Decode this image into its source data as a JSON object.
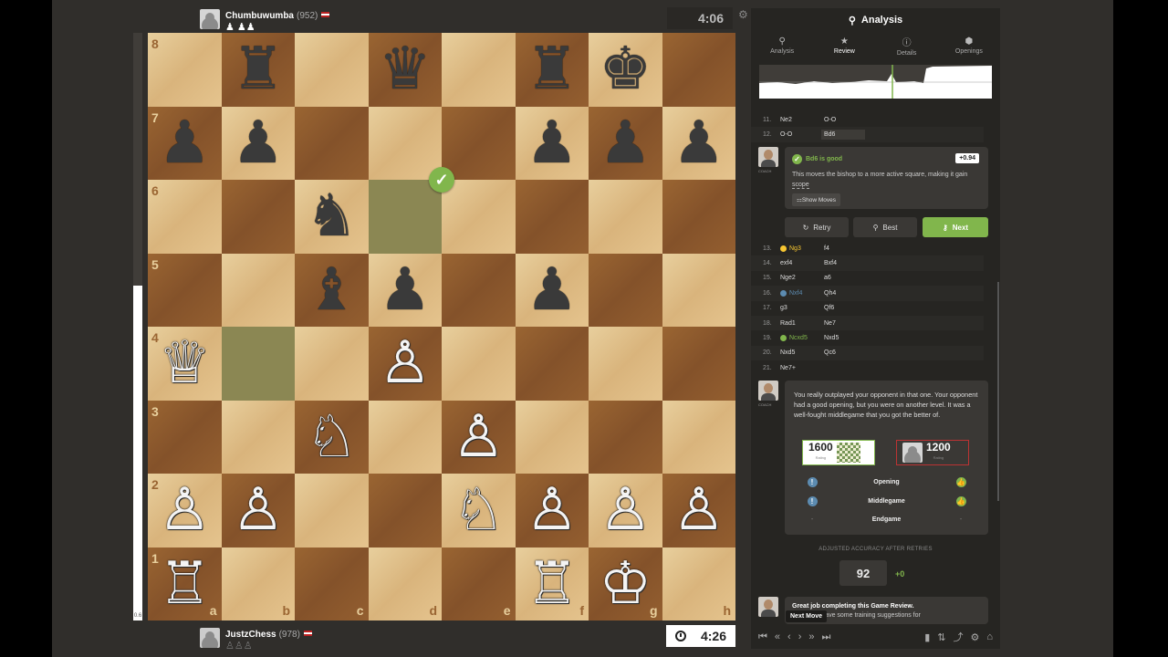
{
  "top_player": {
    "name": "Chumbuwumba",
    "rating": "(952)",
    "captured": "♟ ♟♟",
    "clock": "4:06"
  },
  "bottom_player": {
    "name": "JustzChess",
    "rating": "(978)",
    "captured": "♙♙♙",
    "clock": "4:26"
  },
  "eval_bar": {
    "score": "0.6",
    "white_fraction": 0.57
  },
  "board": {
    "ranks": [
      "8",
      "7",
      "6",
      "5",
      "4",
      "3",
      "2",
      "1"
    ],
    "files": [
      "a",
      "b",
      "c",
      "d",
      "e",
      "f",
      "g",
      "h"
    ],
    "pieces": {
      "b8": "b-rook",
      "d8": "b-queen",
      "f8": "b-rook",
      "g8": "b-king",
      "a7": "b-pawn",
      "b7": "b-pawn",
      "f7": "b-pawn",
      "g7": "b-pawn",
      "h7": "b-pawn",
      "c6": "b-knight",
      "c5": "b-bishop",
      "d5": "b-pawn",
      "f5": "b-pawn",
      "a4": "w-queen",
      "d4": "w-pawn",
      "c3": "w-knight",
      "e3": "w-pawn",
      "a2": "w-pawn",
      "b2": "w-pawn",
      "e2": "w-knight",
      "f2": "w-pawn",
      "g2": "w-pawn",
      "h2": "w-pawn",
      "a1": "w-rook",
      "f1": "w-rook",
      "g1": "w-king"
    },
    "highlighted": [
      "d6",
      "b4"
    ],
    "good_move_square": "d6"
  },
  "panel": {
    "title": "Analysis",
    "tabs": [
      {
        "label": "Analysis",
        "icon": "⚲"
      },
      {
        "label": "Review",
        "icon": "★"
      },
      {
        "label": "Details",
        "icon": "ⓘ"
      },
      {
        "label": "Openings",
        "icon": "⬢"
      }
    ],
    "moves_top": [
      {
        "num": "11.",
        "white": "Ne2",
        "black": "O-O"
      },
      {
        "num": "12.",
        "white": "O-O",
        "black": "Bd6"
      }
    ],
    "coach_label": "COACH",
    "good_card": {
      "title": "Bd6 is good",
      "score": "+0.94",
      "text": "This moves the bishop to a more active square, making it gain",
      "link": "scope",
      "show_moves": "Show Moves"
    },
    "buttons": {
      "retry": "Retry",
      "best": "Best",
      "next": "Next"
    },
    "moves_bottom": [
      {
        "num": "13.",
        "white": "Ng3",
        "black": "f4",
        "mark": "inacc"
      },
      {
        "num": "14.",
        "white": "exf4",
        "black": "Bxf4",
        "mark": ""
      },
      {
        "num": "15.",
        "white": "Nge2",
        "black": "a6",
        "mark": ""
      },
      {
        "num": "16.",
        "white": "Nxf4",
        "black": "Qh4",
        "mark": "mistake"
      },
      {
        "num": "17.",
        "white": "g3",
        "black": "Qf6",
        "mark": ""
      },
      {
        "num": "18.",
        "white": "Rad1",
        "black": "Ne7",
        "mark": ""
      },
      {
        "num": "19.",
        "white": "Ncxd5",
        "black": "Nxd5",
        "mark": "great"
      },
      {
        "num": "20.",
        "white": "Nxd5",
        "black": "Qc6",
        "mark": ""
      },
      {
        "num": "21.",
        "white": "Ne7+",
        "black": "",
        "mark": ""
      }
    ],
    "summary": {
      "text": "You really outplayed your opponent in that one. Your opponent had a good opening, but you were on another level. It was a well-fought middlegame that you got the better of.",
      "white_rating": "1600",
      "black_rating": "1200",
      "rating_label": "Rating",
      "phases": [
        {
          "name": "Opening",
          "left": "!",
          "right": "👍"
        },
        {
          "name": "Middlegame",
          "left": "!",
          "right": "👍"
        },
        {
          "name": "Endgame",
          "left": "-",
          "right": "-"
        }
      ]
    },
    "adjusted_label": "ADJUSTED ACCURACY AFTER RETRIES",
    "accuracy": "92",
    "accuracy_delta": "+0",
    "final": {
      "title": "Great job completing this Game Review.",
      "text": "is game, I have some training suggestions for"
    },
    "tooltip": "Next Move"
  }
}
